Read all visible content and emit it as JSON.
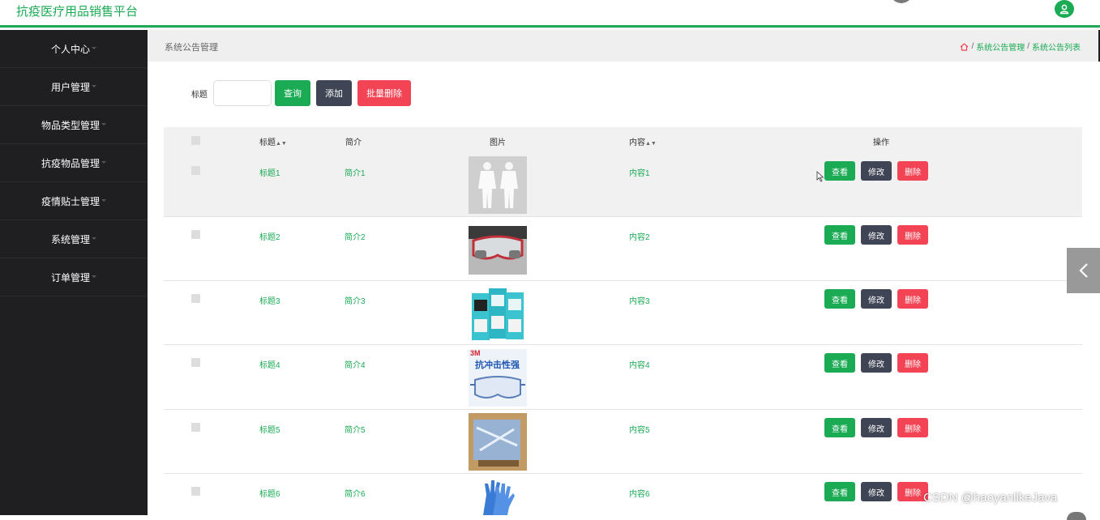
{
  "header": {
    "title": "抗疫医疗用品销售平台"
  },
  "sidebar": {
    "items": [
      {
        "label": "个人中心"
      },
      {
        "label": "用户管理"
      },
      {
        "label": "物品类型管理"
      },
      {
        "label": "抗疫物品管理"
      },
      {
        "label": "疫情贴士管理"
      },
      {
        "label": "系统管理"
      },
      {
        "label": "订单管理"
      }
    ]
  },
  "breadcrumb": {
    "page_title": "系统公告管理",
    "items": [
      "系统公告管理",
      "系统公告列表"
    ],
    "separator": "/"
  },
  "search": {
    "label": "标题",
    "value": "",
    "placeholder": "",
    "query_button": "查询",
    "add_button": "添加",
    "batch_delete_button": "批量删除"
  },
  "table": {
    "headers": {
      "title": "标题",
      "intro": "简介",
      "image": "图片",
      "content": "内容",
      "actions": "操作"
    },
    "row_actions": {
      "view": "查看",
      "edit": "修改",
      "delete": "删除"
    },
    "rows": [
      {
        "title": "标题1",
        "intro": "简介1",
        "image": "protective-suit-image",
        "content": "内容1"
      },
      {
        "title": "标题2",
        "intro": "简介2",
        "image": "goggles-image",
        "content": "内容2"
      },
      {
        "title": "标题3",
        "intro": "简介3",
        "image": "masks-image",
        "content": "内容3"
      },
      {
        "title": "标题4",
        "intro": "简介4",
        "image": "3m-goggles-image",
        "content": "内容4"
      },
      {
        "title": "标题5",
        "intro": "简介5",
        "image": "gown-package-image",
        "content": "内容5"
      },
      {
        "title": "标题6",
        "intro": "简介6",
        "image": "gloves-image",
        "content": "内容6"
      }
    ]
  },
  "image_text": {
    "goggles_brand": "3M",
    "goggles_text": "抗冲击性强"
  },
  "watermark": "CSDN @haoyanlikeJava",
  "colors": {
    "accent": "#1aab54",
    "dark": "#3f4555",
    "danger": "#f24455",
    "sidebar": "#1f1f22"
  }
}
